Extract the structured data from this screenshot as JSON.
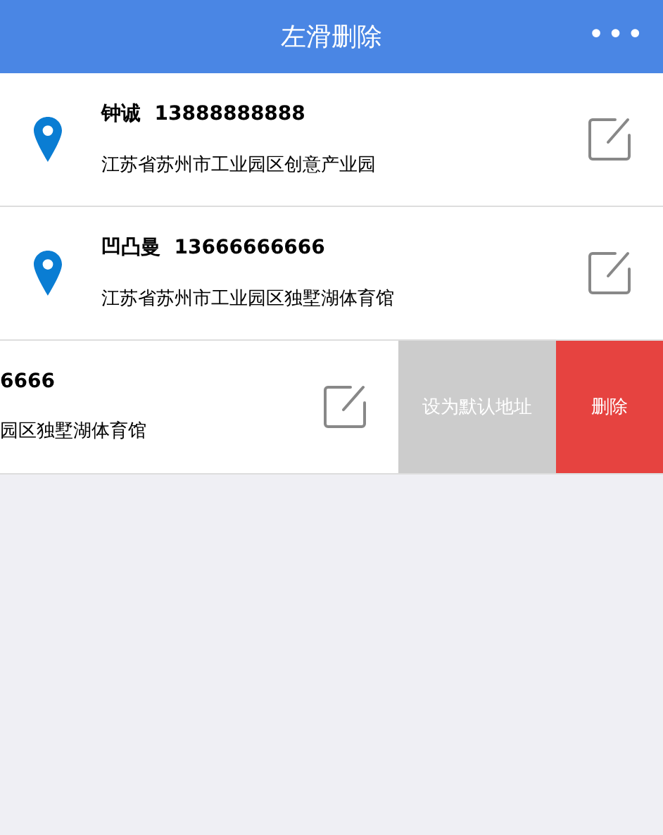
{
  "header": {
    "title": "左滑删除",
    "menu": "•••"
  },
  "addresses": [
    {
      "swiped": false,
      "name": "钟诚",
      "phone": "13888888888",
      "address": "江苏省苏州市工业园区创意产业园"
    },
    {
      "swiped": false,
      "name": "凹凸曼",
      "phone": "13666666666",
      "address": "江苏省苏州市工业园区独墅湖体育馆"
    },
    {
      "swiped": true,
      "phone": "6666",
      "address": "园区独墅湖体育馆",
      "actions": [
        {
          "kind": "default",
          "label": "设为默认地址"
        },
        {
          "kind": "delete",
          "label": "删除"
        }
      ]
    }
  ]
}
